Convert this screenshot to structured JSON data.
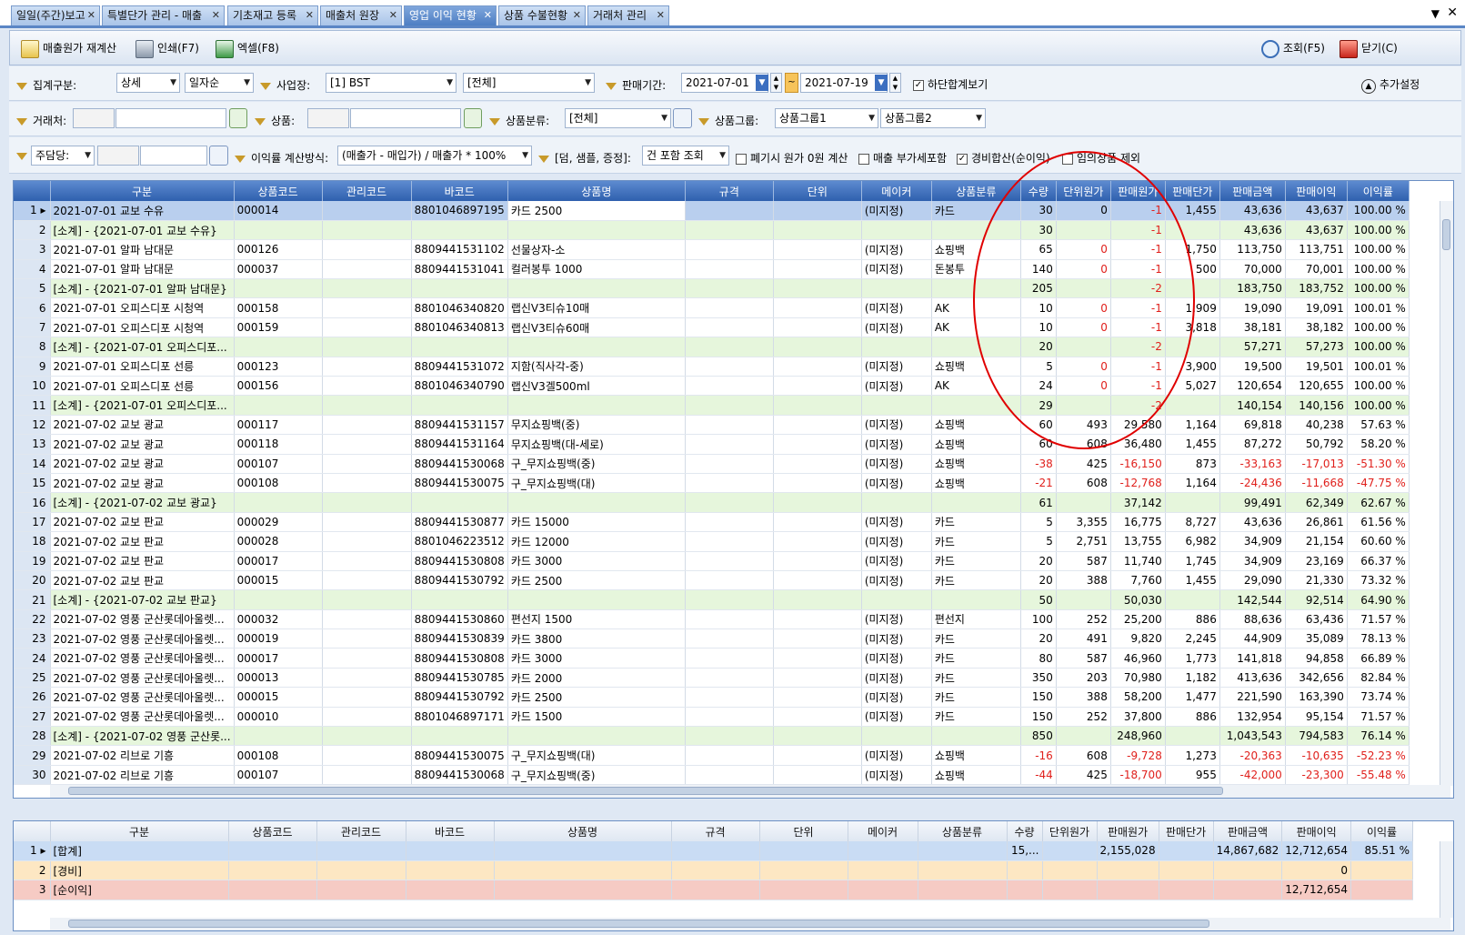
{
  "tabs": [
    {
      "label": "일일(주간)보고",
      "active": false
    },
    {
      "label": "특별단가 관리 - 매출",
      "active": false
    },
    {
      "label": "기초재고 등록",
      "active": false
    },
    {
      "label": "매출처 원장",
      "active": false
    },
    {
      "label": "영업 이익 현황",
      "active": true
    },
    {
      "label": "상품 수불현황",
      "active": false
    },
    {
      "label": "거래처 관리",
      "active": false
    }
  ],
  "toolbar": {
    "recalc_label": "매출원가 재계산",
    "print_label": "인쇄(F7)",
    "excel_label": "엑셀(F8)",
    "search_label": "조회(F5)",
    "close_label": "닫기(C)"
  },
  "filters": {
    "agg_label": "집계구분:",
    "agg_value": "상세",
    "order_value": "일자순",
    "site_label": "사업장:",
    "site_value": "[1] BST",
    "site_sub_value": "[전체]",
    "period_label": "판매기간:",
    "date_from": "2021-07-01",
    "date_to": "2021-07-19",
    "bottom_sum_label": "하단합계보기",
    "extra_label": "추가설정",
    "client_label": "거래처:",
    "product_label": "상품:",
    "product_cat_label": "상품분류:",
    "product_cat_value": "[전체]",
    "product_group_label": "상품그룹:",
    "product_group1": "상품그룹1",
    "product_group2": "상품그룹2",
    "manager_value": "주담당:",
    "calc_method_label": "이익률 계산방식:",
    "calc_method_value": "(매출가 - 매입가) / 매출가 * 100%",
    "extra_items_label": "[덤, 샘플, 증정]:",
    "extra_items_value": "건 포함 조회",
    "opt_disposal": "폐기시 원가 0원 계산",
    "opt_vat": "매출 부가세포함",
    "opt_expense": "경비합산(순이익)",
    "opt_temp": "임의상품 제외"
  },
  "grid": {
    "columns": [
      "구분",
      "상품코드",
      "관리코드",
      "바코드",
      "상품명",
      "규격",
      "단위",
      "메이커",
      "상품분류",
      "수량",
      "단위원가",
      "판매원가",
      "판매단가",
      "판매금액",
      "판매이익",
      "이익률"
    ],
    "rows": [
      {
        "no": "1",
        "kind": "sel",
        "c": [
          "2021-07-01 교보 수유",
          "000014",
          "",
          "8801046897195",
          "카드 2500",
          "",
          "",
          "(미지정)",
          "카드",
          "30",
          "0",
          "-1",
          "1,455",
          "43,636",
          "43,637",
          "100.00 %"
        ]
      },
      {
        "no": "2",
        "kind": "sub",
        "c": [
          "[소계] - {2021-07-01 교보 수유}",
          "",
          "",
          "",
          "",
          "",
          "",
          "",
          "",
          "30",
          "",
          "-1",
          "",
          "43,636",
          "43,637",
          "100.00 %"
        ]
      },
      {
        "no": "3",
        "kind": "",
        "c": [
          "2021-07-01 알파 남대문",
          "000126",
          "",
          "8809441531102",
          "선물상자-소",
          "",
          "",
          "(미지정)",
          "쇼핑백",
          "65",
          "0",
          "-1",
          "1,750",
          "113,750",
          "113,751",
          "100.00 %"
        ]
      },
      {
        "no": "4",
        "kind": "",
        "c": [
          "2021-07-01 알파 남대문",
          "000037",
          "",
          "8809441531041",
          "컬러봉투 1000",
          "",
          "",
          "(미지정)",
          "돈봉투",
          "140",
          "0",
          "-1",
          "500",
          "70,000",
          "70,001",
          "100.00 %"
        ]
      },
      {
        "no": "5",
        "kind": "sub",
        "c": [
          "[소계] - {2021-07-01 알파 남대문}",
          "",
          "",
          "",
          "",
          "",
          "",
          "",
          "",
          "205",
          "",
          "-2",
          "",
          "183,750",
          "183,752",
          "100.00 %"
        ]
      },
      {
        "no": "6",
        "kind": "",
        "c": [
          "2021-07-01 오피스디포 시청역",
          "000158",
          "",
          "8801046340820",
          "랩신V3티슈10매",
          "",
          "",
          "(미지정)",
          "AK",
          "10",
          "0",
          "-1",
          "1,909",
          "19,090",
          "19,091",
          "100.01 %"
        ]
      },
      {
        "no": "7",
        "kind": "",
        "c": [
          "2021-07-01 오피스디포 시청역",
          "000159",
          "",
          "8801046340813",
          "랩신V3티슈60매",
          "",
          "",
          "(미지정)",
          "AK",
          "10",
          "0",
          "-1",
          "3,818",
          "38,181",
          "38,182",
          "100.00 %"
        ]
      },
      {
        "no": "8",
        "kind": "sub",
        "c": [
          "[소계] - {2021-07-01 오피스디포...",
          "",
          "",
          "",
          "",
          "",
          "",
          "",
          "",
          "20",
          "",
          "-2",
          "",
          "57,271",
          "57,273",
          "100.00 %"
        ]
      },
      {
        "no": "9",
        "kind": "",
        "c": [
          "2021-07-01 오피스디포 선릉",
          "000123",
          "",
          "8809441531072",
          "지함(직사각-중)",
          "",
          "",
          "(미지정)",
          "쇼핑백",
          "5",
          "0",
          "-1",
          "3,900",
          "19,500",
          "19,501",
          "100.01 %"
        ]
      },
      {
        "no": "10",
        "kind": "",
        "c": [
          "2021-07-01 오피스디포 선릉",
          "000156",
          "",
          "8801046340790",
          "랩신V3겔500ml",
          "",
          "",
          "(미지정)",
          "AK",
          "24",
          "0",
          "-1",
          "5,027",
          "120,654",
          "120,655",
          "100.00 %"
        ]
      },
      {
        "no": "11",
        "kind": "sub",
        "c": [
          "[소계] - {2021-07-01 오피스디포...",
          "",
          "",
          "",
          "",
          "",
          "",
          "",
          "",
          "29",
          "",
          "-2",
          "",
          "140,154",
          "140,156",
          "100.00 %"
        ]
      },
      {
        "no": "12",
        "kind": "",
        "c": [
          "2021-07-02 교보 광교",
          "000117",
          "",
          "8809441531157",
          "무지쇼핑백(중)",
          "",
          "",
          "(미지정)",
          "쇼핑백",
          "60",
          "493",
          "29,580",
          "1,164",
          "69,818",
          "40,238",
          "57.63 %"
        ]
      },
      {
        "no": "13",
        "kind": "",
        "c": [
          "2021-07-02 교보 광교",
          "000118",
          "",
          "8809441531164",
          "무지쇼핑백(대-세로)",
          "",
          "",
          "(미지정)",
          "쇼핑백",
          "60",
          "608",
          "36,480",
          "1,455",
          "87,272",
          "50,792",
          "58.20 %"
        ]
      },
      {
        "no": "14",
        "kind": "",
        "c": [
          "2021-07-02 교보 광교",
          "000107",
          "",
          "8809441530068",
          "구_무지쇼핑백(중)",
          "",
          "",
          "(미지정)",
          "쇼핑백",
          "-38",
          "425",
          "-16,150",
          "873",
          "-33,163",
          "-17,013",
          "-51.30 %"
        ]
      },
      {
        "no": "15",
        "kind": "",
        "c": [
          "2021-07-02 교보 광교",
          "000108",
          "",
          "8809441530075",
          "구_무지쇼핑백(대)",
          "",
          "",
          "(미지정)",
          "쇼핑백",
          "-21",
          "608",
          "-12,768",
          "1,164",
          "-24,436",
          "-11,668",
          "-47.75 %"
        ]
      },
      {
        "no": "16",
        "kind": "sub",
        "c": [
          "[소계] - {2021-07-02 교보 광교}",
          "",
          "",
          "",
          "",
          "",
          "",
          "",
          "",
          "61",
          "",
          "37,142",
          "",
          "99,491",
          "62,349",
          "62.67 %"
        ]
      },
      {
        "no": "17",
        "kind": "",
        "c": [
          "2021-07-02 교보 판교",
          "000029",
          "",
          "8809441530877",
          "카드 15000",
          "",
          "",
          "(미지정)",
          "카드",
          "5",
          "3,355",
          "16,775",
          "8,727",
          "43,636",
          "26,861",
          "61.56 %"
        ]
      },
      {
        "no": "18",
        "kind": "",
        "c": [
          "2021-07-02 교보 판교",
          "000028",
          "",
          "8801046223512",
          "카드 12000",
          "",
          "",
          "(미지정)",
          "카드",
          "5",
          "2,751",
          "13,755",
          "6,982",
          "34,909",
          "21,154",
          "60.60 %"
        ]
      },
      {
        "no": "19",
        "kind": "",
        "c": [
          "2021-07-02 교보 판교",
          "000017",
          "",
          "8809441530808",
          "카드 3000",
          "",
          "",
          "(미지정)",
          "카드",
          "20",
          "587",
          "11,740",
          "1,745",
          "34,909",
          "23,169",
          "66.37 %"
        ]
      },
      {
        "no": "20",
        "kind": "",
        "c": [
          "2021-07-02 교보 판교",
          "000015",
          "",
          "8809441530792",
          "카드 2500",
          "",
          "",
          "(미지정)",
          "카드",
          "20",
          "388",
          "7,760",
          "1,455",
          "29,090",
          "21,330",
          "73.32 %"
        ]
      },
      {
        "no": "21",
        "kind": "sub",
        "c": [
          "[소계] - {2021-07-02 교보 판교}",
          "",
          "",
          "",
          "",
          "",
          "",
          "",
          "",
          "50",
          "",
          "50,030",
          "",
          "142,544",
          "92,514",
          "64.90 %"
        ]
      },
      {
        "no": "22",
        "kind": "",
        "c": [
          "2021-07-02 영풍 군산롯데아울렛...",
          "000032",
          "",
          "8809441530860",
          "편선지 1500",
          "",
          "",
          "(미지정)",
          "편선지",
          "100",
          "252",
          "25,200",
          "886",
          "88,636",
          "63,436",
          "71.57 %"
        ]
      },
      {
        "no": "23",
        "kind": "",
        "c": [
          "2021-07-02 영풍 군산롯데아울렛...",
          "000019",
          "",
          "8809441530839",
          "카드 3800",
          "",
          "",
          "(미지정)",
          "카드",
          "20",
          "491",
          "9,820",
          "2,245",
          "44,909",
          "35,089",
          "78.13 %"
        ]
      },
      {
        "no": "24",
        "kind": "",
        "c": [
          "2021-07-02 영풍 군산롯데아울렛...",
          "000017",
          "",
          "8809441530808",
          "카드 3000",
          "",
          "",
          "(미지정)",
          "카드",
          "80",
          "587",
          "46,960",
          "1,773",
          "141,818",
          "94,858",
          "66.89 %"
        ]
      },
      {
        "no": "25",
        "kind": "",
        "c": [
          "2021-07-02 영풍 군산롯데아울렛...",
          "000013",
          "",
          "8809441530785",
          "카드 2000",
          "",
          "",
          "(미지정)",
          "카드",
          "350",
          "203",
          "70,980",
          "1,182",
          "413,636",
          "342,656",
          "82.84 %"
        ]
      },
      {
        "no": "26",
        "kind": "",
        "c": [
          "2021-07-02 영풍 군산롯데아울렛...",
          "000015",
          "",
          "8809441530792",
          "카드 2500",
          "",
          "",
          "(미지정)",
          "카드",
          "150",
          "388",
          "58,200",
          "1,477",
          "221,590",
          "163,390",
          "73.74 %"
        ]
      },
      {
        "no": "27",
        "kind": "",
        "c": [
          "2021-07-02 영풍 군산롯데아울렛...",
          "000010",
          "",
          "8801046897171",
          "카드 1500",
          "",
          "",
          "(미지정)",
          "카드",
          "150",
          "252",
          "37,800",
          "886",
          "132,954",
          "95,154",
          "71.57 %"
        ]
      },
      {
        "no": "28",
        "kind": "sub",
        "c": [
          "[소계] - {2021-07-02 영풍 군산롯...",
          "",
          "",
          "",
          "",
          "",
          "",
          "",
          "",
          "850",
          "",
          "248,960",
          "",
          "1,043,543",
          "794,583",
          "76.14 %"
        ]
      },
      {
        "no": "29",
        "kind": "",
        "c": [
          "2021-07-02 리브로 기흥",
          "000108",
          "",
          "8809441530075",
          "구_무지쇼핑백(대)",
          "",
          "",
          "(미지정)",
          "쇼핑백",
          "-16",
          "608",
          "-9,728",
          "1,273",
          "-20,363",
          "-10,635",
          "-52.23 %"
        ]
      },
      {
        "no": "30",
        "kind": "",
        "c": [
          "2021-07-02 리브로 기흥",
          "000107",
          "",
          "8809441530068",
          "구_무지쇼핑백(중)",
          "",
          "",
          "(미지정)",
          "쇼핑백",
          "-44",
          "425",
          "-18,700",
          "955",
          "-42,000",
          "-23,300",
          "-55.48 %"
        ]
      }
    ]
  },
  "summary": {
    "rows": [
      {
        "no": "1",
        "kind": "sum",
        "c": [
          "[합계]",
          "",
          "",
          "",
          "",
          "",
          "",
          "",
          "",
          "15,...",
          "",
          "2,155,028",
          "",
          "14,867,682",
          "12,712,654",
          "85.51 %"
        ]
      },
      {
        "no": "2",
        "kind": "exp",
        "c": [
          "[경비]",
          "",
          "",
          "",
          "",
          "",
          "",
          "",
          "",
          "",
          "",
          "",
          "",
          "",
          "0",
          ""
        ]
      },
      {
        "no": "3",
        "kind": "net",
        "c": [
          "[순이익]",
          "",
          "",
          "",
          "",
          "",
          "",
          "",
          "",
          "",
          "",
          "",
          "",
          "",
          "12,712,654",
          ""
        ]
      }
    ]
  },
  "colors": {
    "accent": "#2f60ae",
    "negative": "#e0201c",
    "subtotal": "#e6f6dc",
    "annotation": "#e00000"
  },
  "icons": [
    "recalc-icon",
    "print-icon",
    "excel-icon",
    "search-icon",
    "close-door-icon",
    "filter-icon",
    "calendar-icon"
  ]
}
